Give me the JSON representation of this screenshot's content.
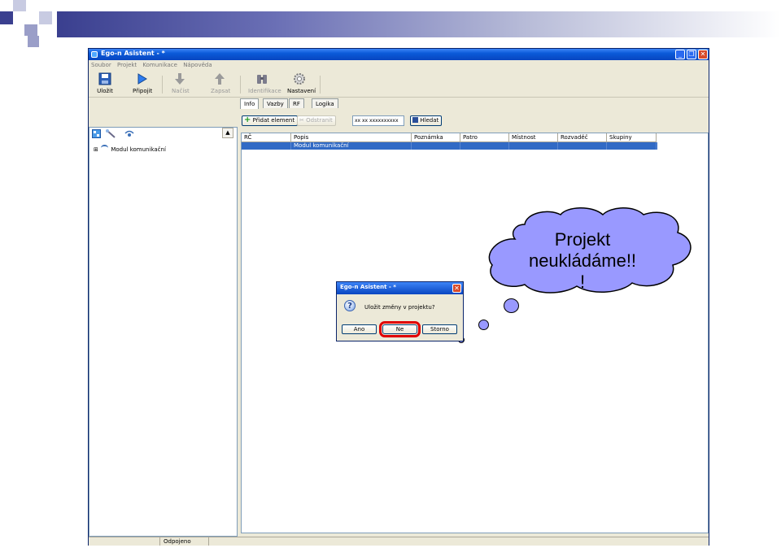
{
  "window": {
    "title": "Ego-n Asistent - *",
    "controls": [
      "_",
      "❐",
      "✕"
    ]
  },
  "menu": [
    "Soubor",
    "Projekt",
    "Komunikace",
    "Nápověda"
  ],
  "toolbar": [
    {
      "label": "Uložit",
      "icon": "save-icon",
      "enabled": true
    },
    {
      "label": "Připojit",
      "icon": "connect-icon",
      "enabled": true
    },
    {
      "label": "Načíst",
      "icon": "download-arrow-icon",
      "enabled": false
    },
    {
      "label": "Zapsat",
      "icon": "upload-arrow-icon",
      "enabled": false
    },
    {
      "label": "Identifikace",
      "icon": "binoculars-icon",
      "enabled": false
    },
    {
      "label": "Nastavení",
      "icon": "settings-icon",
      "enabled": true
    }
  ],
  "tree": {
    "root_label": "Modul komunikační",
    "expander": "⊞"
  },
  "tabs": [
    "Info",
    "Vazby",
    "RF",
    "Logika"
  ],
  "actions": {
    "add": "Přidat element",
    "remove": "Odstranit",
    "search_value": "xx xx xxxxxxxxxx",
    "search": "Hledat"
  },
  "grid": {
    "columns": [
      "RČ",
      "Popis",
      "Poznámka",
      "Patro",
      "Místnost",
      "Rozvaděč",
      "Skupiny"
    ],
    "rows": [
      [
        "",
        "Modul komunikační",
        "",
        "",
        "",
        "",
        ""
      ]
    ]
  },
  "status": {
    "connection": "Odpojeno"
  },
  "dialog": {
    "title": "Ego-n Asistent - *",
    "message": "Uložit změny v projektu?",
    "buttons": {
      "yes": "Ano",
      "no": "Ne",
      "cancel": "Storno"
    }
  },
  "bubble": {
    "line1": "Projekt",
    "line2": "neukládáme!!",
    "line3": "!"
  },
  "colors": {
    "xp_blue": "#0a5ad8",
    "selection": "#316ac5",
    "bubble": "#9999ff",
    "highlight": "#e00000"
  }
}
